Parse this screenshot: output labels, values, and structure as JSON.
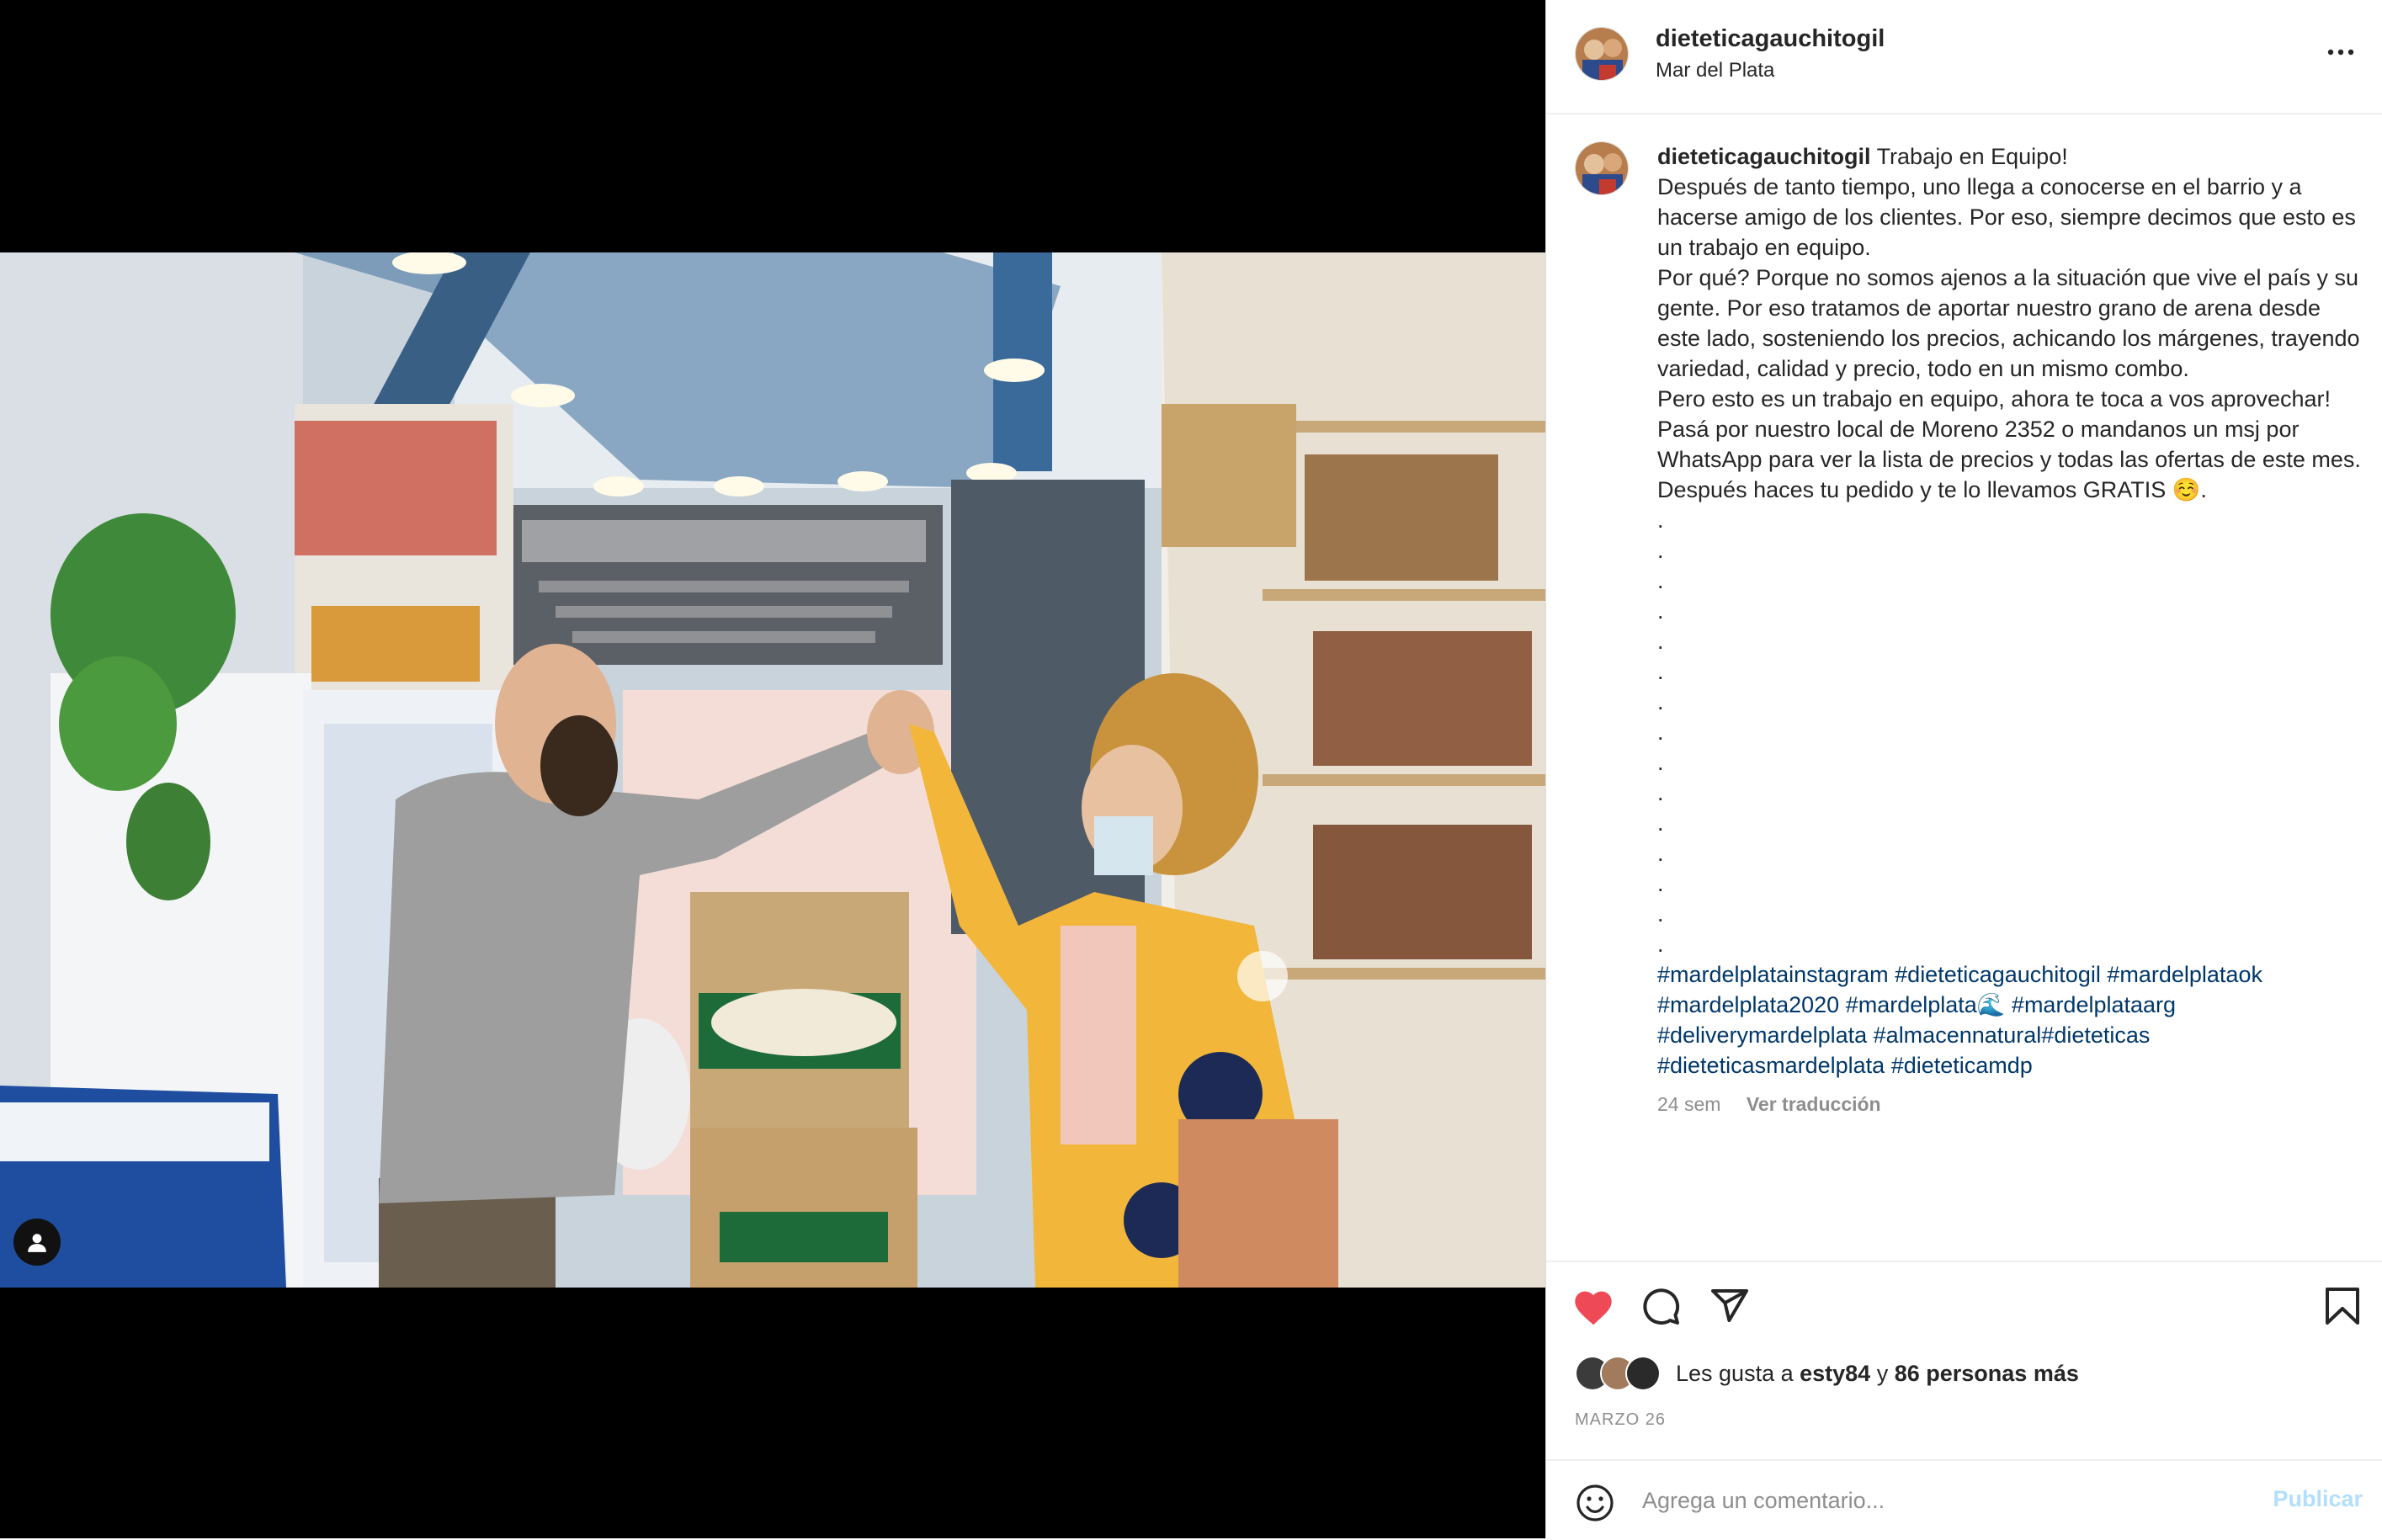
{
  "post": {
    "username": "dieteticagauchitogil",
    "location": "Mar del Plata",
    "more_icon": "more-horizontal-icon"
  },
  "caption": {
    "username": "dieteticagauchitogil",
    "lines": [
      "Trabajo en Equipo!",
      "Después de tanto tiempo, uno llega a conocerse en el barrio y a hacerse amigo de los clientes. Por eso, siempre decimos que esto es un trabajo en equipo.",
      "Por qué? Porque no somos ajenos a la situación que vive el país y su gente. Por eso tratamos de aportar nuestro grano de arena desde este lado, sosteniendo los precios, achicando los márgenes, trayendo variedad, calidad y precio, todo en un mismo combo.",
      "Pero esto es un trabajo en equipo, ahora te toca a vos aprovechar!",
      "Pasá por nuestro local de Moreno 2352 o mandanos un msj por WhatsApp para ver la lista de precios y todas las ofertas de este mes. Después haces tu pedido y te lo llevamos GRATIS ☺️."
    ],
    "dots": [
      ".",
      ".",
      ".",
      ".",
      ".",
      ".",
      ".",
      ".",
      ".",
      ".",
      ".",
      ".",
      ".",
      ".",
      "."
    ],
    "hashtags": [
      "#mardelplatainstagram",
      "#dieteticagauchitogil",
      "#mardelplataok",
      "#mardelplata2020",
      "#mardelplata🌊",
      "#mardelplataarg",
      "#deliverymardelplata",
      "#almacennatural",
      "#dieteticas",
      "#dieteticasmardelplata",
      "#dieteticamdp"
    ],
    "age": "24 sem",
    "translate": "Ver traducción"
  },
  "actions": {
    "like_icon": "heart-filled-icon",
    "like_color": "#ed4956",
    "comment_icon": "comment-icon",
    "share_icon": "send-icon",
    "save_icon": "bookmark-icon"
  },
  "likes": {
    "prefix": "Les gusta a",
    "user": "esty84",
    "joiner": "y",
    "others": "86 personas más"
  },
  "date": "MARZO 26",
  "comment": {
    "placeholder": "Agrega un comentario...",
    "publish": "Publicar",
    "emoji_icon": "emoji-smile-icon"
  },
  "colors": {
    "link": "#00376b",
    "muted": "#8e8e8e",
    "publish_disabled": "#b2dffc"
  }
}
